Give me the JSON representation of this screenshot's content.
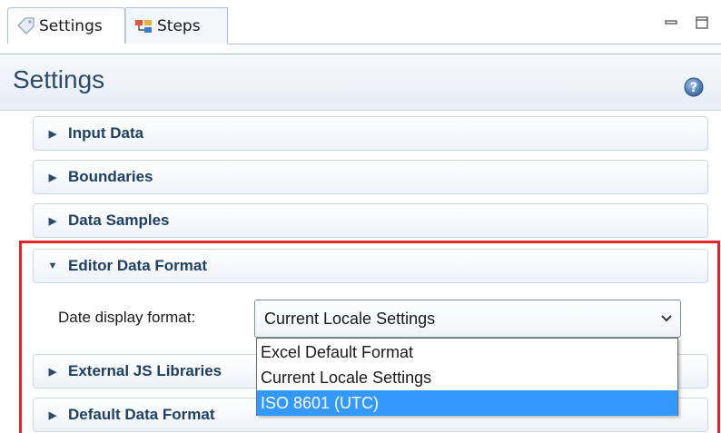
{
  "tabs": [
    {
      "label": "Settings",
      "icon": "settings-tag-icon",
      "active": true
    },
    {
      "label": "Steps",
      "icon": "steps-icon",
      "active": false
    }
  ],
  "window_controls": {
    "minimize_icon": "minimize-icon",
    "maximize_icon": "maximize-icon"
  },
  "header": {
    "title": "Settings",
    "help_icon": "help-icon"
  },
  "sections": [
    {
      "label": "Input Data",
      "expanded": false
    },
    {
      "label": "Boundaries",
      "expanded": false
    },
    {
      "label": "Data Samples",
      "expanded": false
    },
    {
      "label": "Editor Data Format",
      "expanded": true
    },
    {
      "label": "External JS Libraries",
      "expanded": false
    },
    {
      "label": "Default Data Format",
      "expanded": false
    }
  ],
  "editor_data_format": {
    "date_label": "Date display format:",
    "selected_value": "Current Locale Settings",
    "options": [
      "Excel Default Format",
      "Current Locale Settings",
      "ISO 8601 (UTC)"
    ],
    "highlighted_option": "ISO 8601 (UTC)"
  },
  "colors": {
    "highlight": "#3399ff",
    "annotation_border": "#e3242b",
    "header_text": "#2b4a6c",
    "section_text": "#1f3f66"
  }
}
